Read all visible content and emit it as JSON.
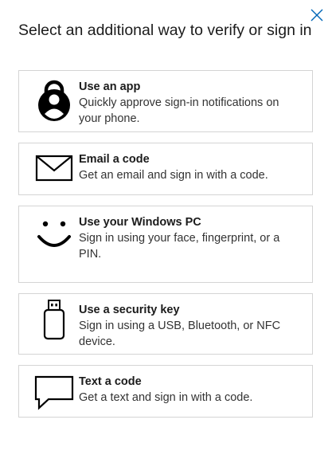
{
  "dialog": {
    "title": "Select an additional way to verify or sign in"
  },
  "icons": {
    "close": "close-icon"
  },
  "options": [
    {
      "label": "Use an app",
      "description": "Quickly approve sign-in notifications on your phone.",
      "icon": "authenticator-app-icon"
    },
    {
      "label": "Email a code",
      "description": "Get an email and sign in with a code.",
      "icon": "email-icon"
    },
    {
      "label": "Use your Windows PC",
      "description": "Sign in using your face, fingerprint, or a PIN.",
      "icon": "windows-hello-icon"
    },
    {
      "label": "Use a security key",
      "description": "Sign in using a USB, Bluetooth, or NFC device.",
      "icon": "security-key-icon"
    },
    {
      "label": "Text a code",
      "description": "Get a text and sign in with a code.",
      "icon": "sms-icon"
    }
  ],
  "colors": {
    "close_icon": "#0067b8",
    "border": "#d4d4d4",
    "text": "#1b1b1b"
  }
}
